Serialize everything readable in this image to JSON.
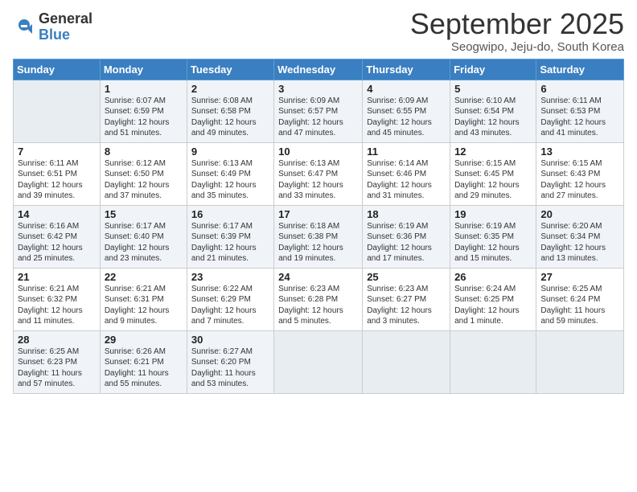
{
  "logo": {
    "general": "General",
    "blue": "Blue"
  },
  "title": "September 2025",
  "subtitle": "Seogwipo, Jeju-do, South Korea",
  "days_of_week": [
    "Sunday",
    "Monday",
    "Tuesday",
    "Wednesday",
    "Thursday",
    "Friday",
    "Saturday"
  ],
  "weeks": [
    [
      {
        "day": "",
        "info": ""
      },
      {
        "day": "1",
        "info": "Sunrise: 6:07 AM\nSunset: 6:59 PM\nDaylight: 12 hours\nand 51 minutes."
      },
      {
        "day": "2",
        "info": "Sunrise: 6:08 AM\nSunset: 6:58 PM\nDaylight: 12 hours\nand 49 minutes."
      },
      {
        "day": "3",
        "info": "Sunrise: 6:09 AM\nSunset: 6:57 PM\nDaylight: 12 hours\nand 47 minutes."
      },
      {
        "day": "4",
        "info": "Sunrise: 6:09 AM\nSunset: 6:55 PM\nDaylight: 12 hours\nand 45 minutes."
      },
      {
        "day": "5",
        "info": "Sunrise: 6:10 AM\nSunset: 6:54 PM\nDaylight: 12 hours\nand 43 minutes."
      },
      {
        "day": "6",
        "info": "Sunrise: 6:11 AM\nSunset: 6:53 PM\nDaylight: 12 hours\nand 41 minutes."
      }
    ],
    [
      {
        "day": "7",
        "info": "Sunrise: 6:11 AM\nSunset: 6:51 PM\nDaylight: 12 hours\nand 39 minutes."
      },
      {
        "day": "8",
        "info": "Sunrise: 6:12 AM\nSunset: 6:50 PM\nDaylight: 12 hours\nand 37 minutes."
      },
      {
        "day": "9",
        "info": "Sunrise: 6:13 AM\nSunset: 6:49 PM\nDaylight: 12 hours\nand 35 minutes."
      },
      {
        "day": "10",
        "info": "Sunrise: 6:13 AM\nSunset: 6:47 PM\nDaylight: 12 hours\nand 33 minutes."
      },
      {
        "day": "11",
        "info": "Sunrise: 6:14 AM\nSunset: 6:46 PM\nDaylight: 12 hours\nand 31 minutes."
      },
      {
        "day": "12",
        "info": "Sunrise: 6:15 AM\nSunset: 6:45 PM\nDaylight: 12 hours\nand 29 minutes."
      },
      {
        "day": "13",
        "info": "Sunrise: 6:15 AM\nSunset: 6:43 PM\nDaylight: 12 hours\nand 27 minutes."
      }
    ],
    [
      {
        "day": "14",
        "info": "Sunrise: 6:16 AM\nSunset: 6:42 PM\nDaylight: 12 hours\nand 25 minutes."
      },
      {
        "day": "15",
        "info": "Sunrise: 6:17 AM\nSunset: 6:40 PM\nDaylight: 12 hours\nand 23 minutes."
      },
      {
        "day": "16",
        "info": "Sunrise: 6:17 AM\nSunset: 6:39 PM\nDaylight: 12 hours\nand 21 minutes."
      },
      {
        "day": "17",
        "info": "Sunrise: 6:18 AM\nSunset: 6:38 PM\nDaylight: 12 hours\nand 19 minutes."
      },
      {
        "day": "18",
        "info": "Sunrise: 6:19 AM\nSunset: 6:36 PM\nDaylight: 12 hours\nand 17 minutes."
      },
      {
        "day": "19",
        "info": "Sunrise: 6:19 AM\nSunset: 6:35 PM\nDaylight: 12 hours\nand 15 minutes."
      },
      {
        "day": "20",
        "info": "Sunrise: 6:20 AM\nSunset: 6:34 PM\nDaylight: 12 hours\nand 13 minutes."
      }
    ],
    [
      {
        "day": "21",
        "info": "Sunrise: 6:21 AM\nSunset: 6:32 PM\nDaylight: 12 hours\nand 11 minutes."
      },
      {
        "day": "22",
        "info": "Sunrise: 6:21 AM\nSunset: 6:31 PM\nDaylight: 12 hours\nand 9 minutes."
      },
      {
        "day": "23",
        "info": "Sunrise: 6:22 AM\nSunset: 6:29 PM\nDaylight: 12 hours\nand 7 minutes."
      },
      {
        "day": "24",
        "info": "Sunrise: 6:23 AM\nSunset: 6:28 PM\nDaylight: 12 hours\nand 5 minutes."
      },
      {
        "day": "25",
        "info": "Sunrise: 6:23 AM\nSunset: 6:27 PM\nDaylight: 12 hours\nand 3 minutes."
      },
      {
        "day": "26",
        "info": "Sunrise: 6:24 AM\nSunset: 6:25 PM\nDaylight: 12 hours\nand 1 minute."
      },
      {
        "day": "27",
        "info": "Sunrise: 6:25 AM\nSunset: 6:24 PM\nDaylight: 11 hours\nand 59 minutes."
      }
    ],
    [
      {
        "day": "28",
        "info": "Sunrise: 6:25 AM\nSunset: 6:23 PM\nDaylight: 11 hours\nand 57 minutes."
      },
      {
        "day": "29",
        "info": "Sunrise: 6:26 AM\nSunset: 6:21 PM\nDaylight: 11 hours\nand 55 minutes."
      },
      {
        "day": "30",
        "info": "Sunrise: 6:27 AM\nSunset: 6:20 PM\nDaylight: 11 hours\nand 53 minutes."
      },
      {
        "day": "",
        "info": ""
      },
      {
        "day": "",
        "info": ""
      },
      {
        "day": "",
        "info": ""
      },
      {
        "day": "",
        "info": ""
      }
    ]
  ]
}
